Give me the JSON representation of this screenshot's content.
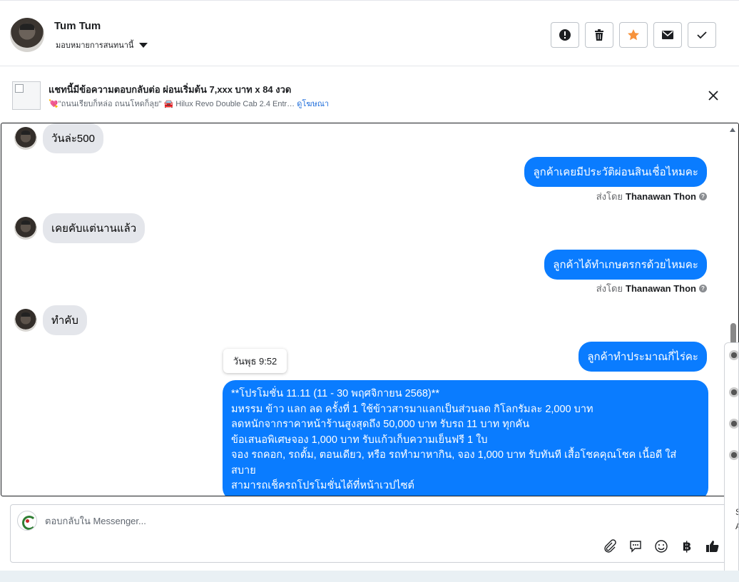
{
  "header": {
    "contact_name": "Tum Tum",
    "assign_label": "มอบหมายการสนทนานี้",
    "tools": [
      {
        "name": "report-icon"
      },
      {
        "name": "trash-icon"
      },
      {
        "name": "star-icon",
        "color": "#f7923b"
      },
      {
        "name": "envelope-icon"
      },
      {
        "name": "check-icon"
      }
    ]
  },
  "ad": {
    "title": "แชทนี้มีข้อความตอบกลับต่อ ผ่อนเริ่มต้น 7,xxx บาท x 84 งวด",
    "subtitle": "💘\"ถนนเรียบก็หล่อ ถนนโหดก็ลุย\" 🚘 Hilux Revo Double Cab 2.4 Entr…",
    "link": "ดูโฆษณา"
  },
  "messages": [
    {
      "direction": "in",
      "text": "วันล่ะ500"
    },
    {
      "direction": "out",
      "text": "ลูกค้าเคยมีประวัติผ่อนสินเชื่อไหมคะ",
      "sent_by_label": "ส่งโดย",
      "sender": "Thanawan Thon"
    },
    {
      "direction": "in",
      "text": "เคยคับแต่นานแล้ว"
    },
    {
      "direction": "out",
      "text": "ลูกค้าได้ทำเกษตรกรด้วยไหมคะ",
      "sent_by_label": "ส่งโดย",
      "sender": "Thanawan Thon"
    },
    {
      "direction": "in",
      "text": "ทำคับ"
    },
    {
      "direction": "out",
      "text": "ลูกค้าทำประมาณกี่ไร่คะ"
    }
  ],
  "tooltip": "วันพุธ 9:52",
  "promo_lines": [
    "**โปรโมชั่น 11.11  (11 - 30 พฤศจิกายน 2568)**",
    "มหรรม ข้าว แลก ลด ครั้งที่ 1 ใช้ข้าวสารมาแลกเป็นส่วนลด กิโลกรัมละ 2,000 บาท",
    "ลดหนักจากราคาหน้าร้านสูงสุดถึง 50,000 บาท รับรถ 11 บาท ทุกคัน",
    "ข้อเสนอพิเศษจอง 1,000 บาท รับแก้วเก็บความเย็นฟรี 1 ใบ",
    "จอง รถคอก, รถตั้ม, ตอนเดียว, หรือ รถทำมาหากิน, จอง 1,000 บาท รับทันที เสื้อโชคคุณโชค เนื้อดี ใส่สบาย",
    "สามารถเช็ครถโปรโมชั่นได้ที่หน้าเวปไซต์"
  ],
  "composer": {
    "placeholder": "ตอบกลับใน Messenger...",
    "tools": [
      "paperclip-icon",
      "speech-bubble-icon",
      "smiley-icon",
      "baht-icon",
      "thumbs-up-icon"
    ],
    "baht_symbol": "฿"
  },
  "side_panel": {
    "letters": [
      "S",
      "A"
    ]
  }
}
